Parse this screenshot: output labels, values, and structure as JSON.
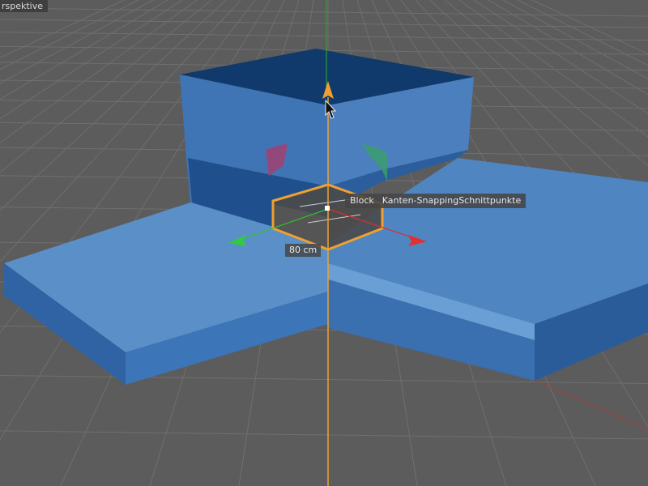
{
  "viewport": {
    "view_name": "rspektive",
    "background_color": "#5c5c5c",
    "grid_color": "#6f6f6f"
  },
  "snap_tooltip": {
    "object": "Block",
    "mode": "Kanten-Snapping",
    "target": "Schnittpunkte"
  },
  "dimension_label": "80 cm",
  "colors": {
    "selection_highlight": "#f0a030",
    "axis_x": "#e03030",
    "axis_y": "#30c030",
    "axis_z": "#2ecc40",
    "model_face_top": "#5b8fc8",
    "model_face_side": "#2a5c99",
    "model_face_dark": "#0f3a6b"
  },
  "icons": {
    "cursor": "arrow-cursor-icon",
    "move_y_handle": "orange-arrow-handle-icon",
    "move_x_handle": "red-arrow-handle-icon",
    "move_z_handle": "green-arrow-handle-icon",
    "rotate_handle": "rotate-arc-handle-icon"
  }
}
